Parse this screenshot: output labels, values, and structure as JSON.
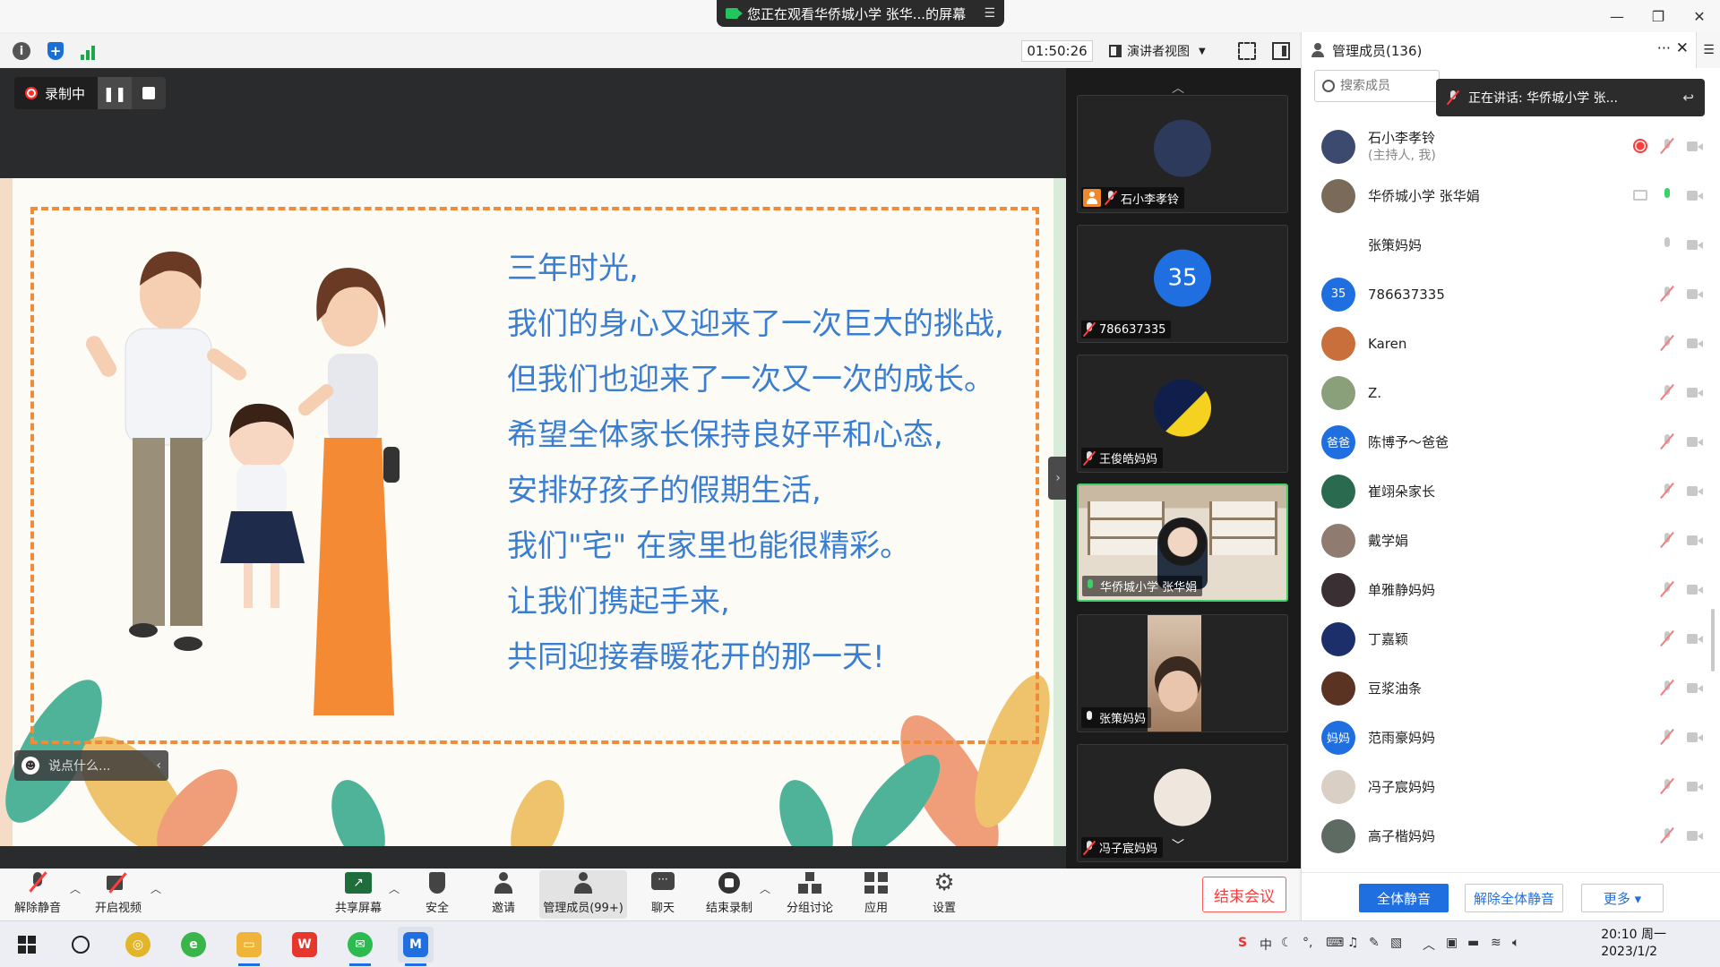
{
  "topbar": {
    "share_status": "您正在观看华侨城小学 张华...的屏幕",
    "menu_icon": "list-icon",
    "window_controls": [
      "minimize-icon",
      "restore-icon",
      "close-icon"
    ]
  },
  "toolbar2": {
    "timer": "01:50:26",
    "view_mode": "演讲者视图",
    "icons": [
      "info-icon",
      "security-shield-icon",
      "signal-icon",
      "fullscreen-icon",
      "layout-icon"
    ]
  },
  "recording": {
    "label": "录制中",
    "pause_label": "❚❚"
  },
  "slide": {
    "lines": [
      "三年时光,",
      "我们的身心又迎来了一次巨大的挑战,",
      "但我们也迎来了一次又一次的成长。",
      "希望全体家长保持良好平和心态,",
      "安排好孩子的假期生活,",
      "我们\"宅\" 在家里也能很精彩。",
      "让我们携起手来,",
      "共同迎接春暖花开的那一天!"
    ],
    "frame_color": "#f08b3a",
    "text_color": "#3a7ed1"
  },
  "chat_input": {
    "placeholder": "说点什么..."
  },
  "video_strip": {
    "tiles": [
      {
        "name": "石小李孝铃",
        "avatar_color": "#2d3a5c",
        "host": true,
        "mic": "off"
      },
      {
        "name": "786637335",
        "avatar_text": "35",
        "avatar_color": "#1f6fe0",
        "mic": "off"
      },
      {
        "name": "王俊皓妈妈",
        "avatar_color": "#1d3d8f",
        "mic": "off"
      },
      {
        "name": "华侨城小学 张华娟",
        "mic": "on",
        "active": true
      },
      {
        "name": "张策妈妈",
        "mic": "on"
      },
      {
        "name": "冯子宸妈妈",
        "avatar_color": "#d9cfc4",
        "mic": "off"
      }
    ]
  },
  "panel": {
    "title": "管理成员(136)",
    "more": "···",
    "close": "✕",
    "edge": "☰",
    "search_placeholder": "搜索成员",
    "speaking": "正在讲话: 华侨城小学 张...",
    "back": "↩",
    "members": [
      {
        "name": "石小李孝铃",
        "sub": "(主持人, 我)",
        "avatar_color": "#3b4a6e",
        "rec": true,
        "mic": "off",
        "cam": "off"
      },
      {
        "name": "华侨城小学 张华娟",
        "avatar_color": "#7a6a5a",
        "screen": true,
        "mic": "on",
        "cam": "on"
      },
      {
        "name": "张策妈妈",
        "avatar_color": "",
        "mic": "on",
        "cam": "on"
      },
      {
        "name": "786637335",
        "avatar_text": "35",
        "avatar_color": "#1f6fe0",
        "mic": "off",
        "cam": "off"
      },
      {
        "name": "Karen",
        "avatar_color": "#c96f3b",
        "mic": "off",
        "cam": "off"
      },
      {
        "name": "Z.",
        "avatar_color": "#8aa07a",
        "mic": "off",
        "cam": "off"
      },
      {
        "name": "陈博予～爸爸",
        "avatar_text": "爸爸",
        "avatar_color": "#1f6fe0",
        "mic": "off",
        "cam": "off"
      },
      {
        "name": "崔翊朵家长",
        "avatar_color": "#2a6b4f",
        "mic": "off",
        "cam": "off"
      },
      {
        "name": "戴学娟",
        "avatar_color": "#8f7b70",
        "mic": "off",
        "cam": "off"
      },
      {
        "name": "单雅静妈妈",
        "avatar_color": "#3a2f33",
        "mic": "off",
        "cam": "off"
      },
      {
        "name": "丁嘉颖",
        "avatar_color": "#1c2f6b",
        "mic": "off",
        "cam": "off"
      },
      {
        "name": "豆浆油条",
        "avatar_color": "#5a3322",
        "mic": "off",
        "cam": "off"
      },
      {
        "name": "范雨豪妈妈",
        "avatar_text": "妈妈",
        "avatar_color": "#1f6fe0",
        "mic": "off",
        "cam": "off"
      },
      {
        "name": "冯子宸妈妈",
        "avatar_color": "#d9cfc4",
        "mic": "off",
        "cam": "off"
      },
      {
        "name": "高子楷妈妈",
        "avatar_color": "#5d6b63",
        "mic": "off",
        "cam": "off"
      }
    ],
    "footer": {
      "mute_all": "全体静音",
      "unmute_all": "解除全体静音",
      "more": "更多 ▾"
    }
  },
  "bottombar": {
    "mute": "解除静音",
    "video": "开启视频",
    "share": "共享屏幕",
    "security": "安全",
    "invite": "邀请",
    "members": "管理成员(99+)",
    "chat": "聊天",
    "stop_rec": "结束录制",
    "breakout": "分组讨论",
    "apps": "应用",
    "settings": "设置",
    "end": "结束会议"
  },
  "taskbar": {
    "tray_ime": "中",
    "time": "20:10 周一",
    "date": "2023/1/2",
    "app_icons": [
      "windows-start-icon",
      "search-icon",
      "app-360-icon",
      "browser-icon",
      "file-explorer-icon",
      "wps-icon",
      "wechat-icon",
      "tencent-meeting-icon"
    ]
  }
}
